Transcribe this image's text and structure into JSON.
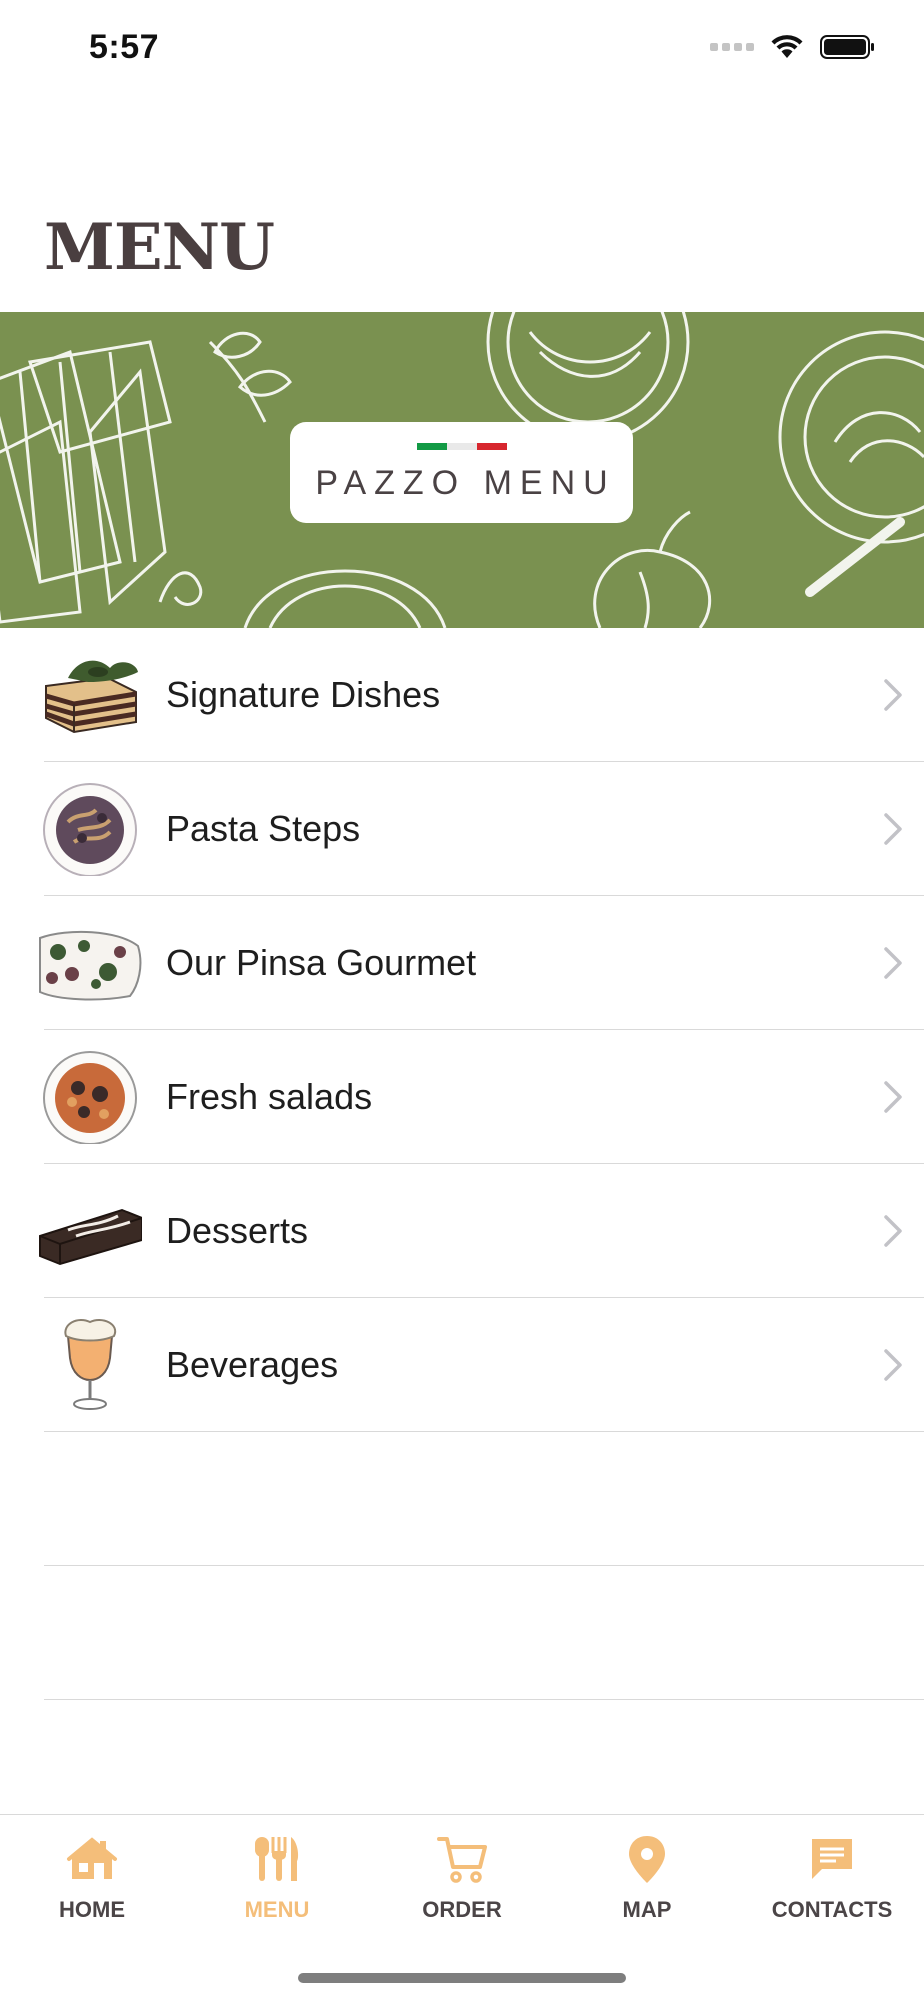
{
  "status": {
    "time": "5:57"
  },
  "page": {
    "title": "MENU"
  },
  "banner": {
    "brand": "PAZZO MENU",
    "flag_colors": [
      "#129a45",
      "#e9e9e9",
      "#d7262e"
    ],
    "background": "#7a9150"
  },
  "menu_items": [
    {
      "label": "Signature Dishes",
      "icon": "lasagna-icon"
    },
    {
      "label": "Pasta Steps",
      "icon": "pasta-plate-icon"
    },
    {
      "label": "Our Pinsa Gourmet",
      "icon": "pinsa-icon"
    },
    {
      "label": "Fresh salads",
      "icon": "salad-plate-icon"
    },
    {
      "label": "Desserts",
      "icon": "cake-slice-icon"
    },
    {
      "label": "Beverages",
      "icon": "beer-glass-icon"
    }
  ],
  "tabs": [
    {
      "label": "HOME",
      "icon": "house-icon",
      "active": false
    },
    {
      "label": "MENU",
      "icon": "fork-knife-icon",
      "active": true
    },
    {
      "label": "ORDER",
      "icon": "cart-icon",
      "active": false
    },
    {
      "label": "MAP",
      "icon": "map-pin-icon",
      "active": false
    },
    {
      "label": "CONTACTS",
      "icon": "chat-icon",
      "active": false
    }
  ],
  "colors": {
    "accent": "#f4be7a",
    "tab_label": "#4b4547",
    "title": "#4a3f40"
  }
}
